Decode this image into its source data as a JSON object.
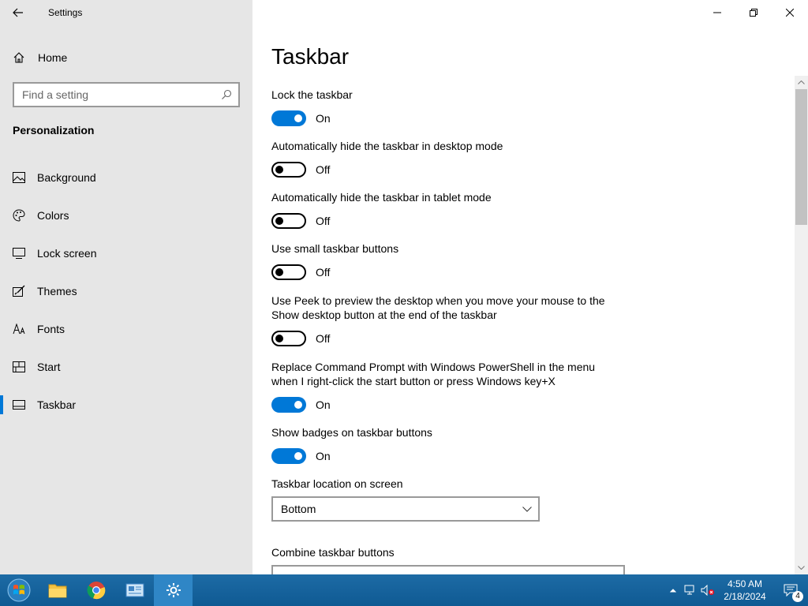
{
  "window": {
    "title": "Settings"
  },
  "sidebar": {
    "home_label": "Home",
    "search_placeholder": "Find a setting",
    "section_title": "Personalization",
    "items": [
      {
        "label": "Background",
        "icon": "background-icon"
      },
      {
        "label": "Colors",
        "icon": "palette-icon"
      },
      {
        "label": "Lock screen",
        "icon": "lock-screen-icon"
      },
      {
        "label": "Themes",
        "icon": "themes-icon"
      },
      {
        "label": "Fonts",
        "icon": "fonts-icon"
      },
      {
        "label": "Start",
        "icon": "start-icon"
      },
      {
        "label": "Taskbar",
        "icon": "taskbar-icon",
        "active": true
      }
    ]
  },
  "main": {
    "title": "Taskbar",
    "settings": [
      {
        "label": "Lock the taskbar",
        "state": "On"
      },
      {
        "label": "Automatically hide the taskbar in desktop mode",
        "state": "Off"
      },
      {
        "label": "Automatically hide the taskbar in tablet mode",
        "state": "Off"
      },
      {
        "label": "Use small taskbar buttons",
        "state": "Off"
      },
      {
        "label": "Use Peek to preview the desktop when you move your mouse to the Show desktop button at the end of the taskbar",
        "state": "Off"
      },
      {
        "label": "Replace Command Prompt with Windows PowerShell in the menu when I right-click the start button or press Windows key+X",
        "state": "On"
      },
      {
        "label": "Show badges on taskbar buttons",
        "state": "On"
      }
    ],
    "location_label": "Taskbar location on screen",
    "location_value": "Bottom",
    "combine_label": "Combine taskbar buttons"
  },
  "taskbar": {
    "time": "4:50 AM",
    "date": "2/18/2024",
    "notification_count": "4"
  },
  "colors": {
    "accent": "#0078d7",
    "sidebar_bg": "#e6e6e6",
    "taskbar_bg": "#0f5a93"
  }
}
